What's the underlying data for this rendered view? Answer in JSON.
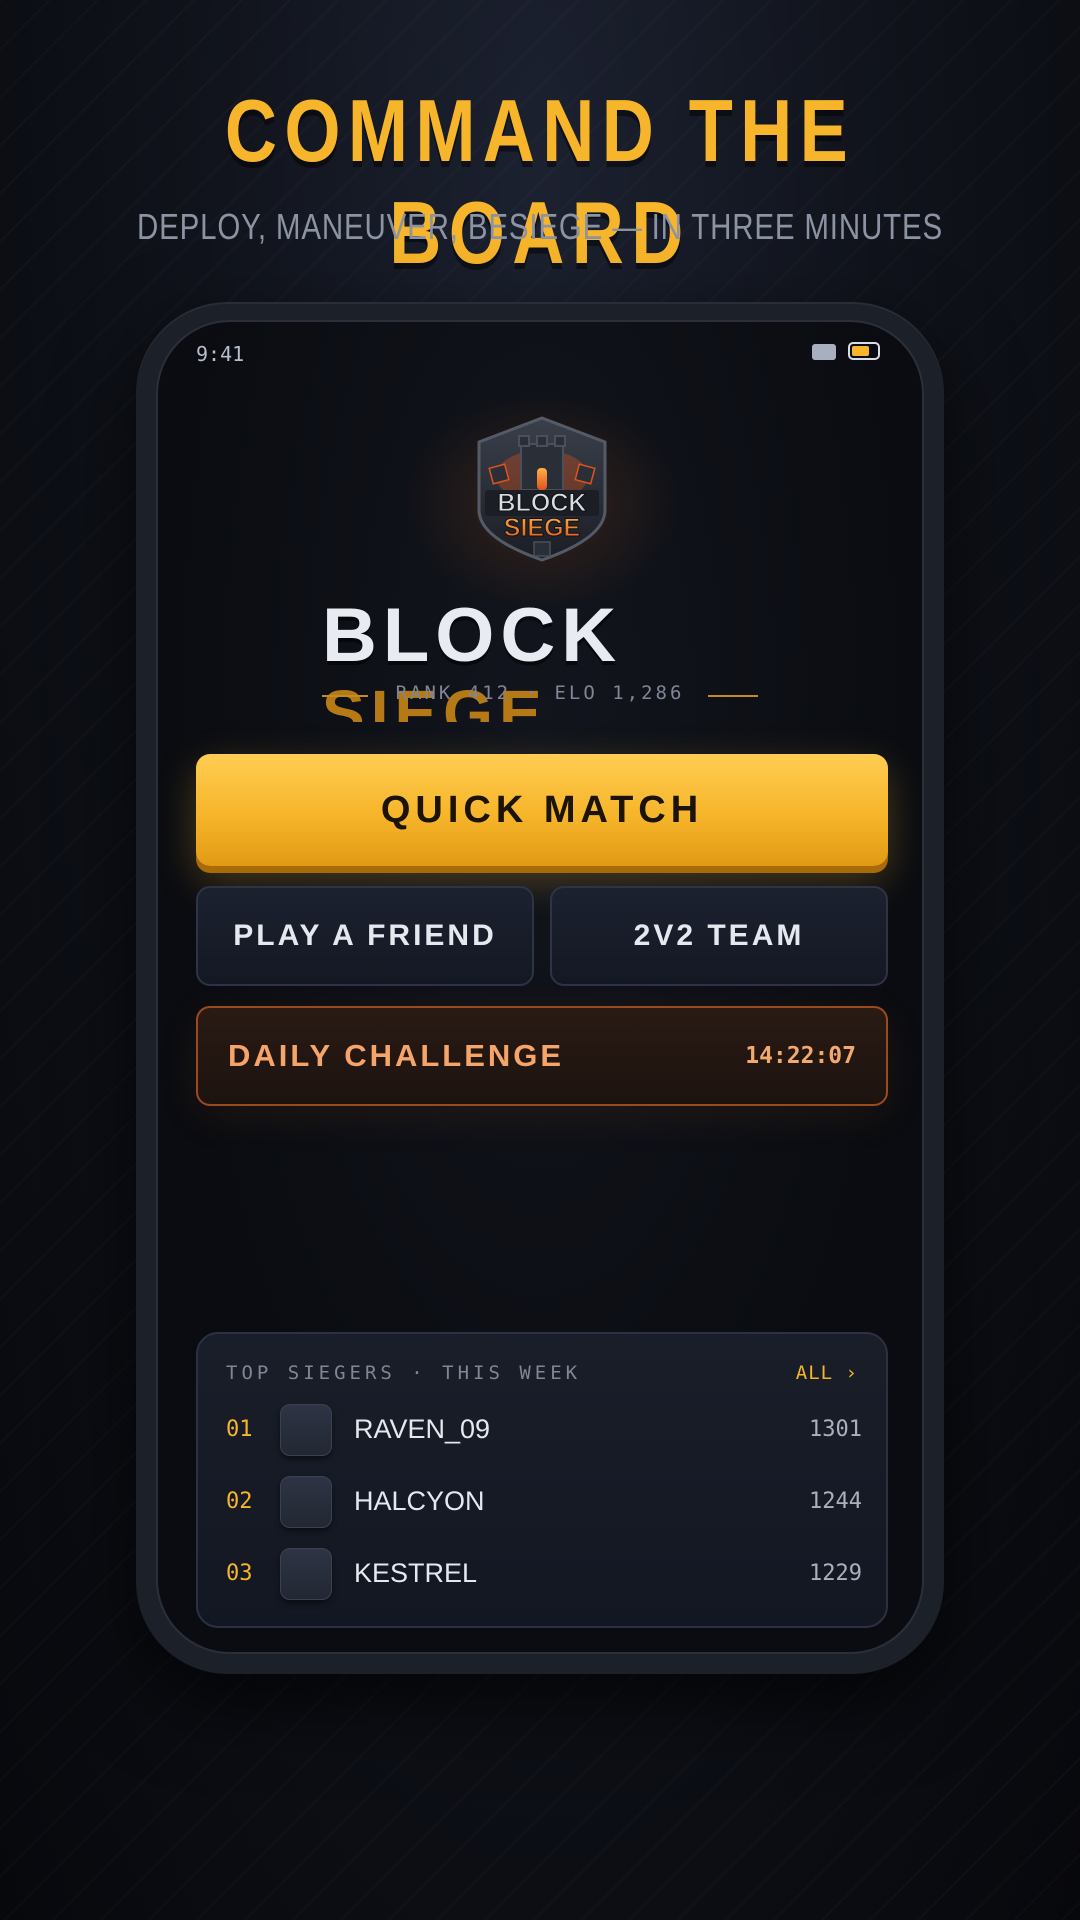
{
  "headline": "COMMAND THE BOARD",
  "subheadline": "DEPLOY, MANEUVER, BESIEGE — IN THREE MINUTES",
  "status_bar": {
    "time": "9:41",
    "battery_color": "#f6b52a"
  },
  "logo": {
    "icon": "block-siege-castle-logo-icon",
    "line1": "BLOCK",
    "line2": "SIEGE"
  },
  "game_title": {
    "line1": "BLOCK",
    "line2": "SIEGE"
  },
  "player_stats": "RANK 412 · ELO 1,286",
  "buttons": {
    "quick_match": "QUICK MATCH",
    "play_friend": "PLAY A FRIEND",
    "team": "2V2 TEAM",
    "daily_challenge": "DAILY CHALLENGE",
    "daily_timer": "14:22:07"
  },
  "leaderboard": {
    "title": "TOP SIEGERS · THIS WEEK",
    "all_link": "ALL ›",
    "rows": [
      {
        "rank": "01",
        "name": "RAVEN_09",
        "score": "1301"
      },
      {
        "rank": "02",
        "name": "HALCYON",
        "score": "1244"
      },
      {
        "rank": "03",
        "name": "KESTREL",
        "score": "1229"
      }
    ]
  },
  "colors": {
    "accent": "#f6b52a",
    "daily_accent": "#f5a46a",
    "background": "#0b0d12"
  }
}
